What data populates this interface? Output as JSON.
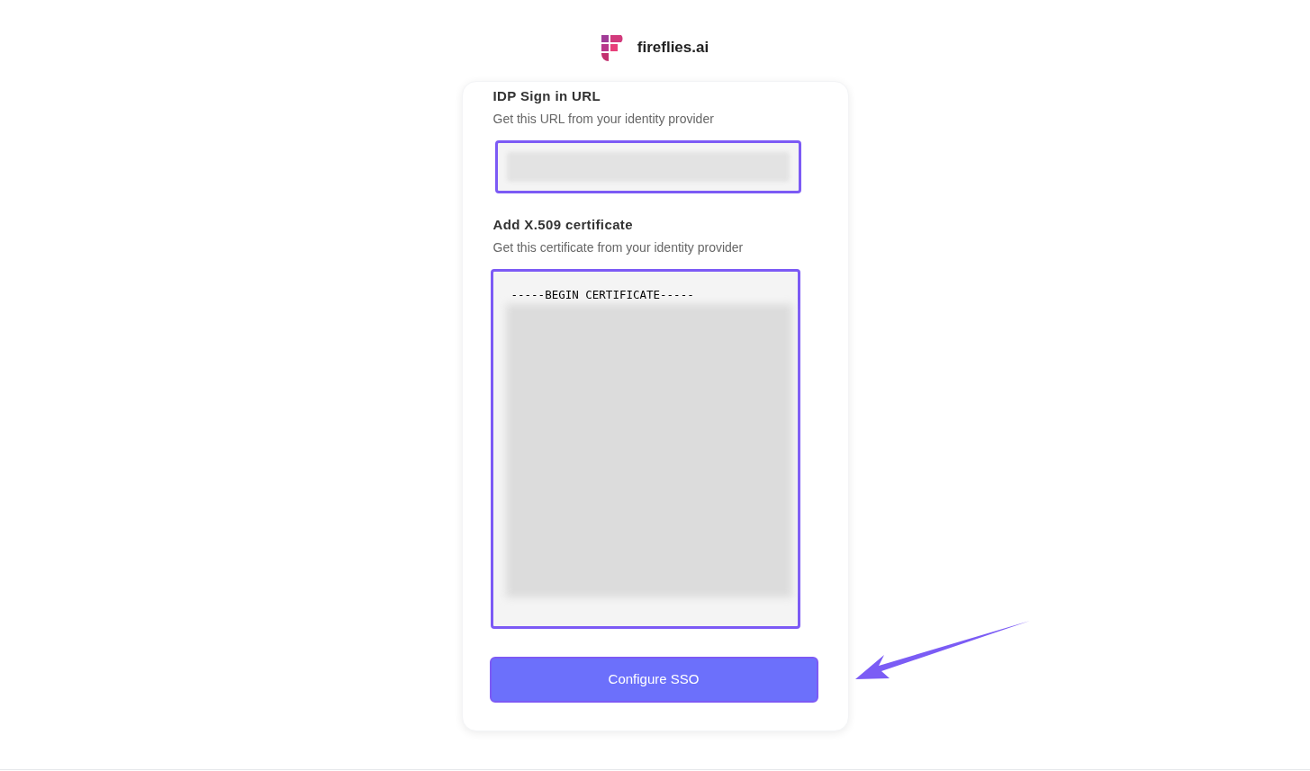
{
  "logo": {
    "text": "fireflies.ai"
  },
  "fields": [
    {
      "kind": "url",
      "label": "IDP Sign in URL",
      "hint": "Get this URL from your identity provider"
    },
    {
      "kind": "certificate",
      "label": "Add X.509 certificate",
      "hint": "Get this certificate from your identity provider",
      "value": "-----BEGIN CERTIFICATE-----"
    }
  ],
  "button": {
    "label": "Configure SSO"
  }
}
